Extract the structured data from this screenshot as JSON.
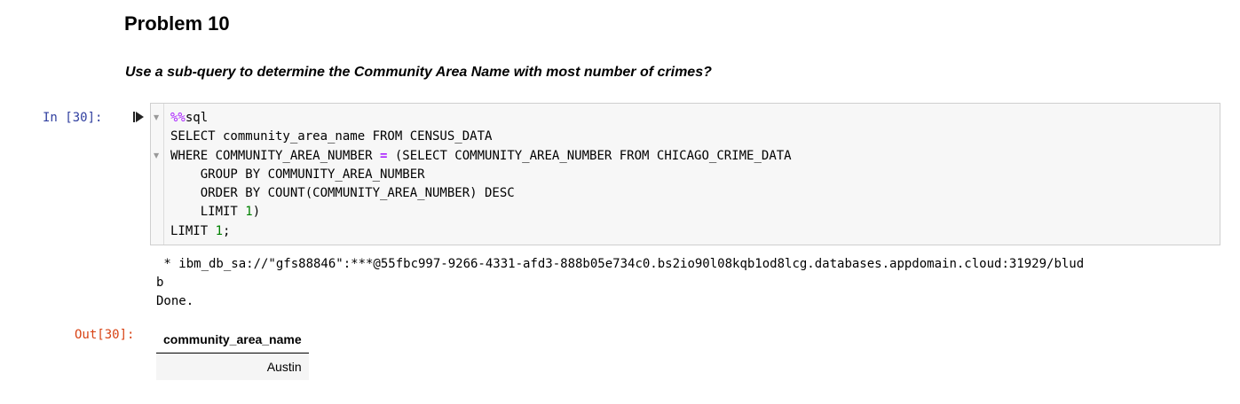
{
  "heading": "Problem 10",
  "question": "Use a sub-query to determine the Community Area Name with most number of crimes?",
  "input_cell": {
    "prompt": "In [30]:",
    "code": {
      "magic": "%%",
      "line1": "sql",
      "line2": "SELECT community_area_name FROM CENSUS_DATA",
      "line3_a": "WHERE COMMUNITY_AREA_NUMBER ",
      "line3_op": "=",
      "line3_b": " (SELECT COMMUNITY_AREA_NUMBER FROM CHICAGO_CRIME_DATA",
      "line4": "    GROUP BY COMMUNITY_AREA_NUMBER",
      "line5": "    ORDER BY COUNT(COMMUNITY_AREA_NUMBER) DESC",
      "line6_a": "    LIMIT ",
      "line6_num": "1",
      "line6_b": ")",
      "line7_a": "LIMIT ",
      "line7_num": "1",
      "line7_b": ";"
    },
    "icons": {
      "run": "run-cell-icon",
      "fold": "fold-arrow-icon"
    }
  },
  "output_cell": {
    "prompt": "Out[30]:",
    "stdout_line1": " * ibm_db_sa://\"gfs88846\":***@55fbc997-9266-4331-afd3-888b05e734c0.bs2io90l08kqb1od8lcg.databases.appdomain.cloud:31929/blud",
    "stdout_line2": "b",
    "stdout_line3": "Done.",
    "table": {
      "columns": [
        "community_area_name"
      ],
      "rows": [
        [
          "Austin"
        ]
      ]
    }
  },
  "colors": {
    "prompt_in": "#303f9f",
    "prompt_out": "#d84315",
    "magic": "#aa22ff",
    "number": "#008000",
    "cell_bg": "#f7f7f7",
    "cell_border": "#cfcfcf"
  }
}
